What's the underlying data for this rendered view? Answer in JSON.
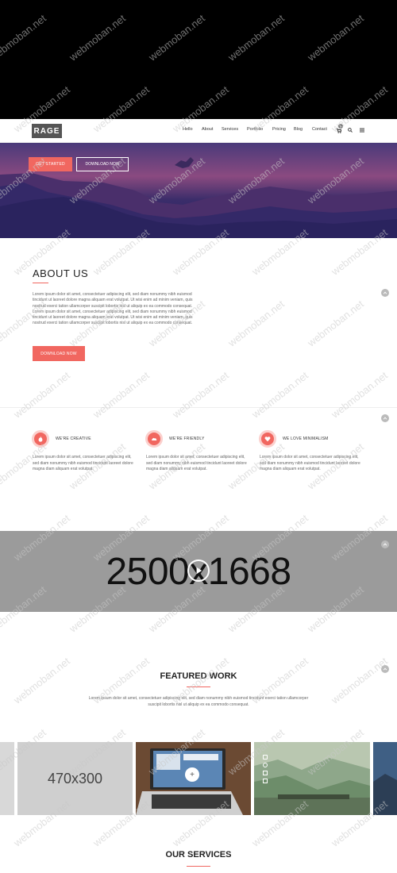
{
  "header": {
    "logo": "RAGE",
    "nav": [
      "Hello",
      "About",
      "Services",
      "Portfolio",
      "Pricing",
      "Blog",
      "Contact"
    ],
    "cart_count": "0"
  },
  "hero": {
    "primary_button": "GET STARTED",
    "secondary_button": "DOWNLOAD NOW"
  },
  "about": {
    "title": "ABOUT US",
    "body": "Lorem ipsum dolor sit amet, consectetuer adipiscing elit, sed diam nonummy nibh euismod tincidunt ut laoreet dolore magna aliquam erat volutpat. Ut wisi enim ad minim veniam, quis nostrud exerci tation ullamcorper suscipit lobortis nisl ut aliquip ex ea commodo consequat. Lorem ipsum dolor sit amet, consectetuer adipiscing elit, sed diam nonummy nibh euismod tincidunt ut laoreet dolore magna aliquam erat volutpat. Ut wisi enim ad minim veniam, quis nostrud exerci tation ullamcorper suscipit lobortis nisl ut aliquip ex ea commodo consequat.",
    "button": "DOWNLOAD NOW"
  },
  "features": [
    {
      "title": "WE'RE CREATIVE",
      "icon": "flame-icon",
      "text": "Lorem ipsum dolor sit amet, consectetuer adipiscing elit, sed diam nonummy nibh euismod tincidunt laoreet dolore magna diam aliquam erat volutpat."
    },
    {
      "title": "WE'RE FRIENDLY",
      "icon": "cloud-icon",
      "text": "Lorem ipsum dolor sit amet, consectetuer adipiscing elit, sed diam nonummy nibh euismod tincidunt laoreet dolore magna diam aliquam erat volutpat."
    },
    {
      "title": "WE LOVE MINIMALISM",
      "icon": "heart-icon",
      "text": "Lorem ipsum dolor sit amet, consectetuer adipiscing elit, sed diam nonummy nibh euismod tincidunt laoreet dolore magna diam aliquam erat volutpat."
    }
  ],
  "video": {
    "placeholder": "2500x1668"
  },
  "featured_work": {
    "title": "FEATURED WORK",
    "text": "Lorem ipsum dolor sit amet, consectetuer adipiscing elit, sed diam nonummy nibh euismod tincidunt exerci tation ullamcorper suscipit lobortis nisl ut aliquip ex ea commodo consequat.",
    "placeholder": "470x300"
  },
  "services": {
    "title": "OUR SERVICES"
  },
  "watermark": "webmoban.net",
  "colors": {
    "accent": "#f16760",
    "hero_sky": "#3d2f6e",
    "hero_glow": "#a04a7c"
  }
}
